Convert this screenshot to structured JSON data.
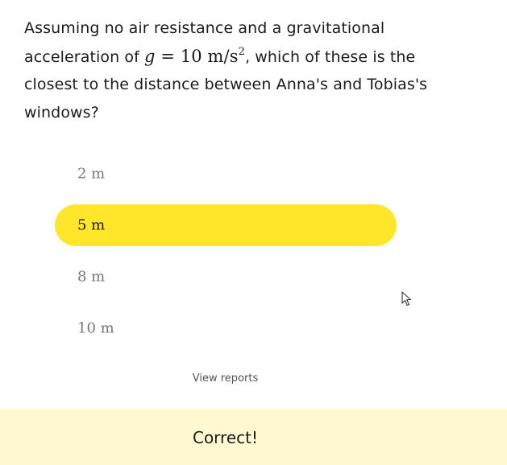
{
  "question": {
    "part1": "Assuming no air resistance and a gravitational acceleration of ",
    "math_var": "g",
    "math_eq": " = 10 m/s",
    "math_exp": "2",
    "part2": ", which of these is the closest to the distance between Anna's and Tobias's windows?"
  },
  "options": [
    {
      "label": "2 m",
      "selected": false
    },
    {
      "label": "5 m",
      "selected": true
    },
    {
      "label": "8 m",
      "selected": false
    },
    {
      "label": "10 m",
      "selected": false
    }
  ],
  "links": {
    "view_reports": "View reports"
  },
  "feedback": {
    "text": "Correct!"
  },
  "colors": {
    "selected_option": "#ffe62b",
    "feedback_bar": "#fff8d1"
  },
  "icons": {
    "cursor": "mouse-pointer-icon"
  }
}
